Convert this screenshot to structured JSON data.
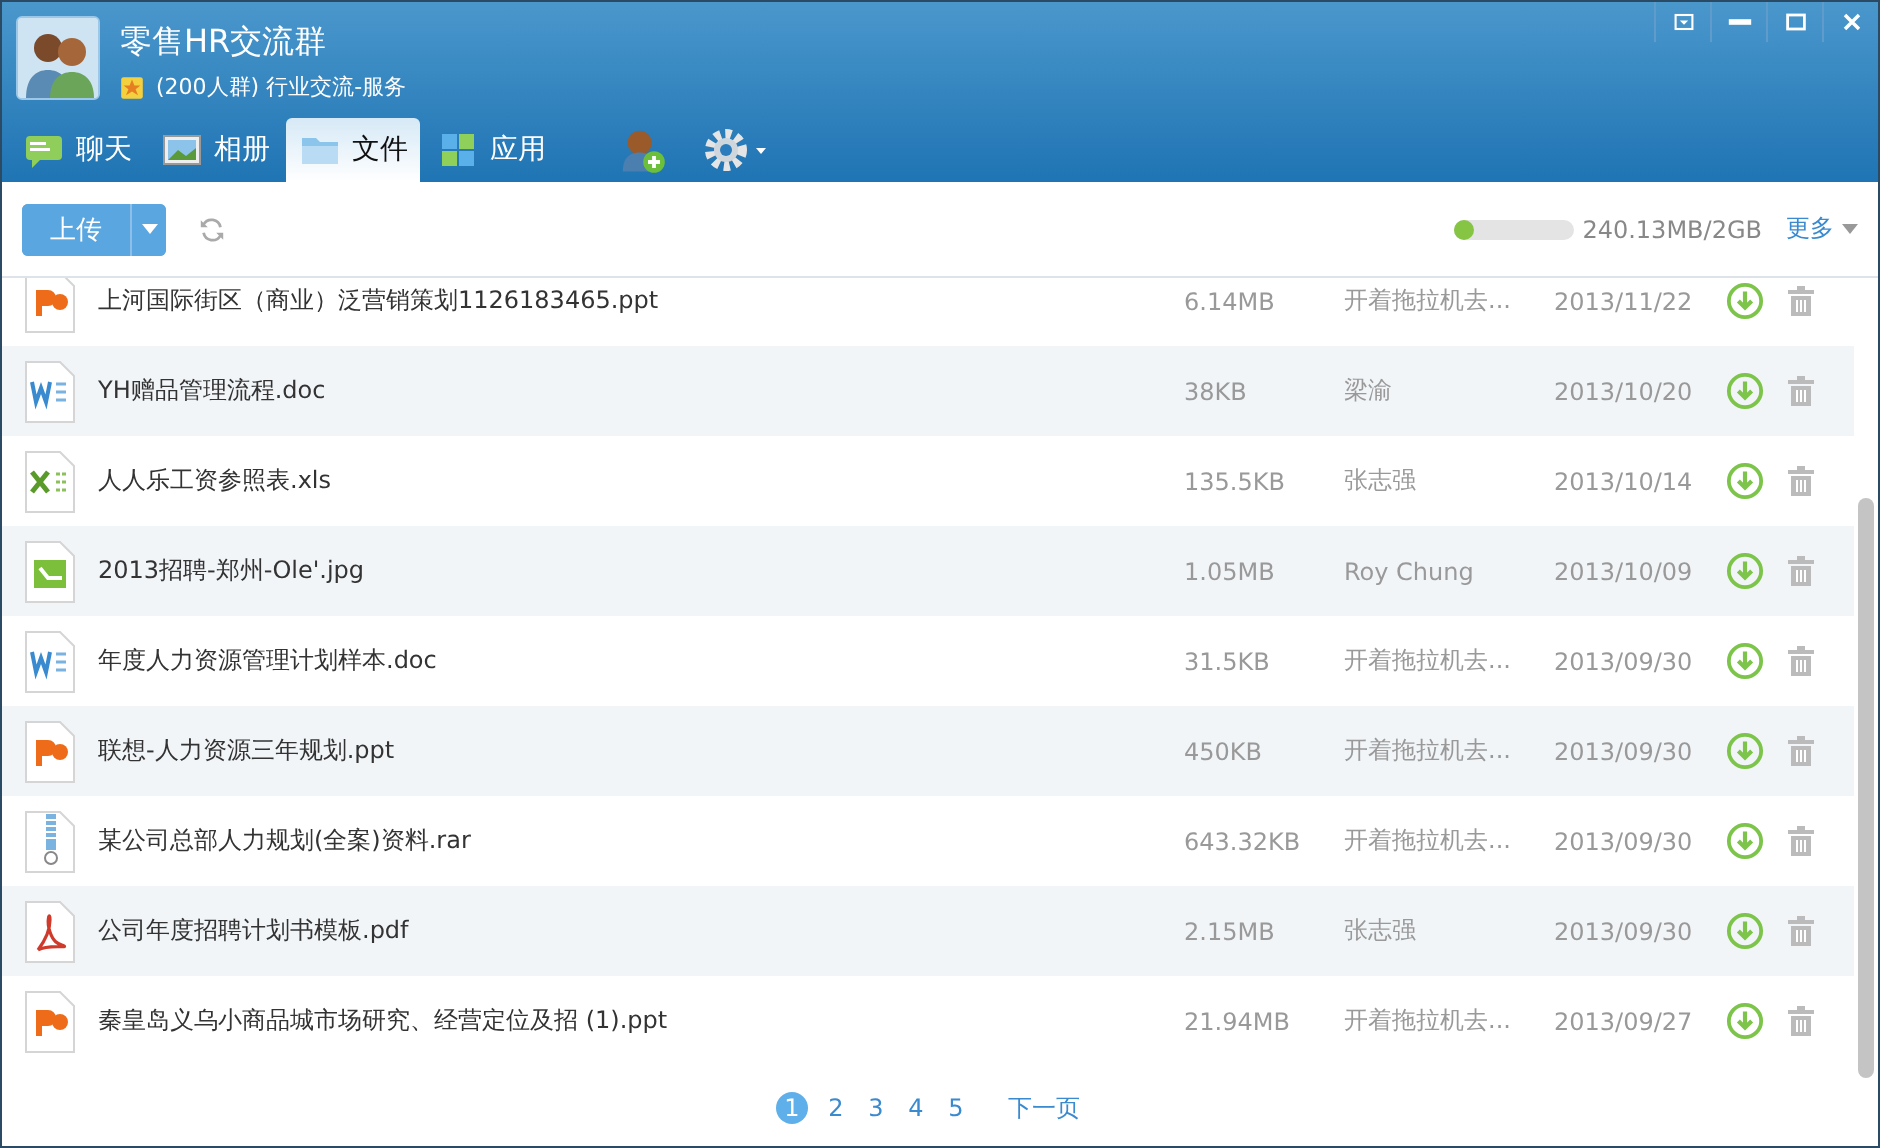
{
  "window": {
    "title": "零售HR交流群",
    "subtitle": "(200人群) 行业交流-服务"
  },
  "tabs": [
    {
      "label": "聊天",
      "selected": false
    },
    {
      "label": "相册",
      "selected": false
    },
    {
      "label": "文件",
      "selected": true
    },
    {
      "label": "应用",
      "selected": false
    }
  ],
  "toolbar": {
    "upload": "上传",
    "storage": {
      "level": 0.12,
      "reading": "240.13MB/2GB"
    },
    "more": "更多"
  },
  "files": [
    {
      "kind": "ppt",
      "name": "上河国际街区（商业）泛营销策划1126183465.ppt",
      "size": "6.14MB",
      "uploader": "开着拖拉机去...",
      "date": "2013/11/22"
    },
    {
      "kind": "doc",
      "name": "YH赠品管理流程.doc",
      "size": "38KB",
      "uploader": "梁渝",
      "date": "2013/10/20"
    },
    {
      "kind": "xls",
      "name": "人人乐工资参照表.xls",
      "size": "135.5KB",
      "uploader": "张志强",
      "date": "2013/10/14"
    },
    {
      "kind": "jpg",
      "name": "2013招聘-郑州-Ole'.jpg",
      "size": "1.05MB",
      "uploader": "Roy Chung",
      "date": "2013/10/09"
    },
    {
      "kind": "doc",
      "name": "年度人力资源管理计划样本.doc",
      "size": "31.5KB",
      "uploader": "开着拖拉机去...",
      "date": "2013/09/30"
    },
    {
      "kind": "ppt",
      "name": "联想-人力资源三年规划.ppt",
      "size": "450KB",
      "uploader": "开着拖拉机去...",
      "date": "2013/09/30"
    },
    {
      "kind": "rar",
      "name": "某公司总部人力规划(全案)资料.rar",
      "size": "643.32KB",
      "uploader": "开着拖拉机去...",
      "date": "2013/09/30"
    },
    {
      "kind": "pdf",
      "name": "公司年度招聘计划书模板.pdf",
      "size": "2.15MB",
      "uploader": "张志强",
      "date": "2013/09/30"
    },
    {
      "kind": "ppt",
      "name": "秦皇岛义乌小商品城市场研究、经营定位及招 (1).ppt",
      "size": "21.94MB",
      "uploader": "开着拖拉机去...",
      "date": "2013/09/27"
    }
  ],
  "pagination": {
    "pages": [
      {
        "label": "1",
        "selected": true
      },
      {
        "label": "2",
        "selected": false
      },
      {
        "label": "3",
        "selected": false
      },
      {
        "label": "4",
        "selected": false
      },
      {
        "label": "5",
        "selected": false
      }
    ],
    "next": "下一页"
  }
}
